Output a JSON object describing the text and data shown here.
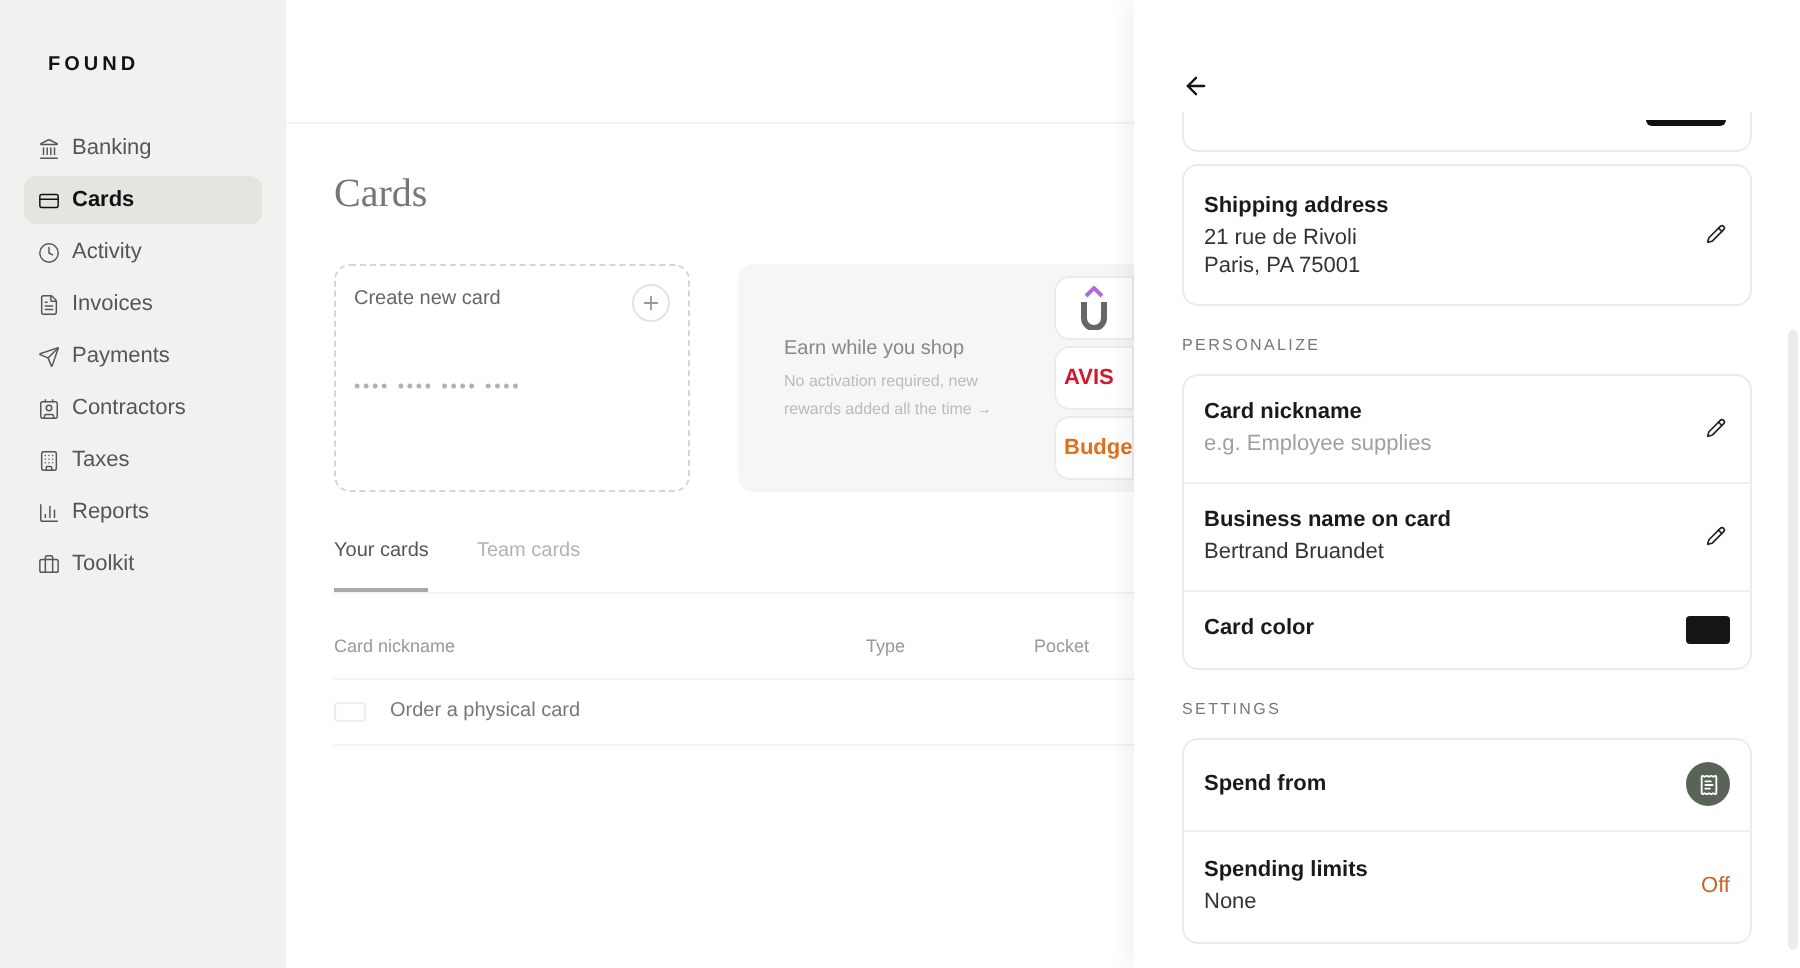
{
  "brand": "FOUND",
  "sidebar": {
    "items": [
      {
        "label": "Banking",
        "selected": false
      },
      {
        "label": "Cards",
        "selected": true
      },
      {
        "label": "Activity",
        "selected": false
      },
      {
        "label": "Invoices",
        "selected": false
      },
      {
        "label": "Payments",
        "selected": false
      },
      {
        "label": "Contractors",
        "selected": false
      },
      {
        "label": "Taxes",
        "selected": false
      },
      {
        "label": "Reports",
        "selected": false
      },
      {
        "label": "Toolkit",
        "selected": false
      }
    ]
  },
  "page": {
    "title": "Cards",
    "create_card": {
      "label": "Create new card",
      "number": "•••• •••• •••• ••••"
    },
    "rewards": {
      "title": "Earn while you shop",
      "text": "No activation required, new rewards added all the time →",
      "logos": [
        {
          "kind": "u"
        },
        {
          "kind": "text",
          "text": "AVIS",
          "color": "#d4182c"
        },
        {
          "kind": "text",
          "text": "Budge",
          "color": "#e0701c"
        }
      ]
    },
    "tabs": [
      {
        "label": "Your cards",
        "selected": true
      },
      {
        "label": "Team cards",
        "selected": false
      }
    ],
    "table": {
      "columns": [
        "Card nickname",
        "Type",
        "Pocket"
      ],
      "rows": [
        {
          "label": "Order a physical card"
        }
      ]
    }
  },
  "drawer": {
    "shipping": {
      "title": "Shipping address",
      "lines": [
        "21 rue de Rivoli",
        "Paris, PA 75001"
      ]
    },
    "sections": [
      {
        "heading": "PERSONALIZE",
        "rows": [
          {
            "kind": "edit",
            "title": "Card nickname",
            "value": "e.g. Employee supplies",
            "placeholder": true
          },
          {
            "kind": "edit",
            "title": "Business name on card",
            "value": "Bertrand Bruandet",
            "placeholder": false
          },
          {
            "kind": "swatch",
            "title": "Card color"
          }
        ]
      },
      {
        "heading": "SETTINGS",
        "rows": [
          {
            "kind": "pocket",
            "title": "Spend from"
          },
          {
            "kind": "status",
            "title": "Spending limits",
            "value": "None",
            "status": "Off"
          }
        ]
      }
    ]
  }
}
